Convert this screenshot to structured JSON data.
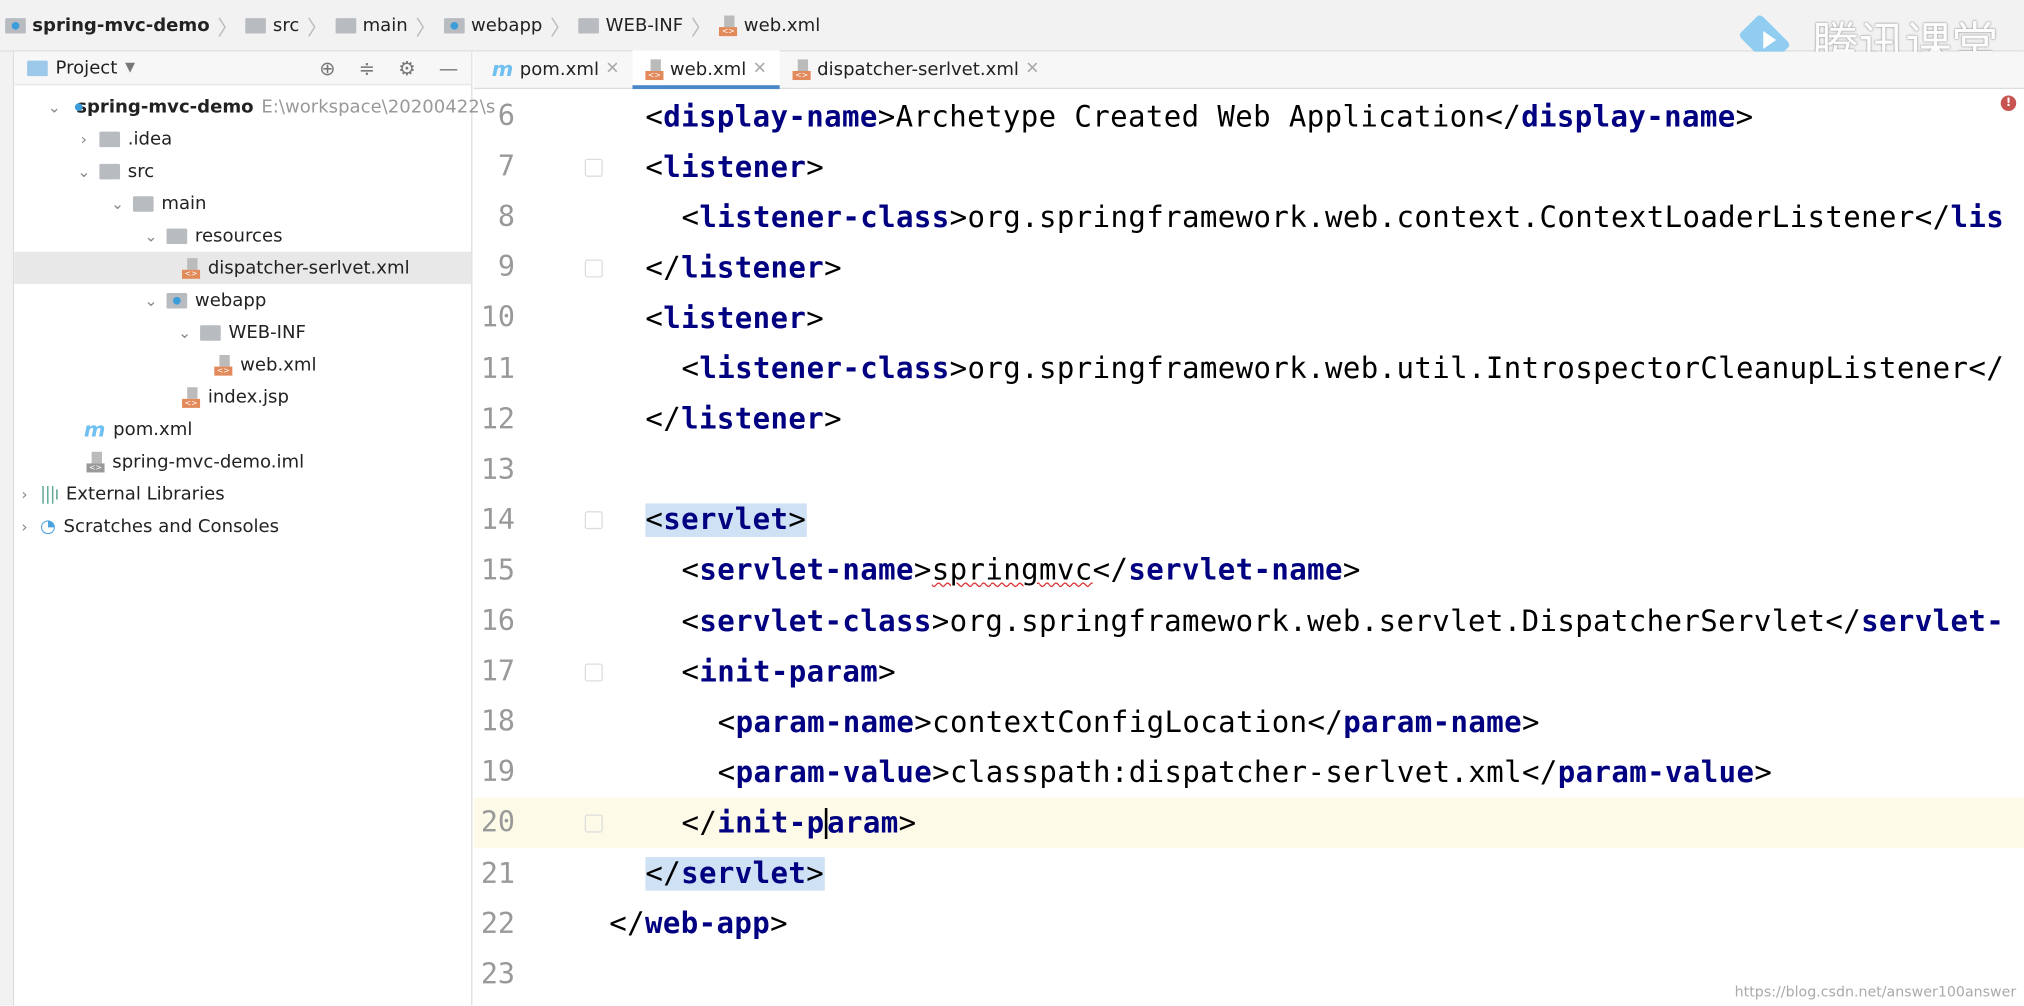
{
  "breadcrumb": [
    {
      "label": "spring-mvc-demo",
      "icon": "module-icon"
    },
    {
      "label": "src",
      "icon": "folder-icon"
    },
    {
      "label": "main",
      "icon": "folder-icon"
    },
    {
      "label": "webapp",
      "icon": "web-folder-icon"
    },
    {
      "label": "WEB-INF",
      "icon": "folder-icon"
    },
    {
      "label": "web.xml",
      "icon": "xml-file-icon"
    }
  ],
  "project_panel": {
    "title": "Project",
    "root": {
      "label": "spring-mvc-demo",
      "path": "E:\\workspace\\20200422\\s"
    },
    "items": [
      ".idea",
      "src",
      "main",
      "resources",
      "dispatcher-serlvet.xml",
      "webapp",
      "WEB-INF",
      "web.xml",
      "index.jsp",
      "pom.xml",
      "spring-mvc-demo.iml",
      "External Libraries",
      "Scratches and Consoles"
    ]
  },
  "tabs": [
    {
      "label": "pom.xml",
      "active": false
    },
    {
      "label": "web.xml",
      "active": true
    },
    {
      "label": "dispatcher-serlvet.xml",
      "active": false
    }
  ],
  "code": {
    "current_line": 20,
    "lines": [
      {
        "n": "6",
        "text": [
          "<",
          "display-name",
          ">Archetype Created Web Application</",
          "display-name",
          ">"
        ]
      },
      {
        "n": "7",
        "text": [
          "<",
          "listener",
          ">"
        ]
      },
      {
        "n": "8",
        "text": [
          "<",
          "listener-class",
          ">org.springframework.web.context.ContextLoaderListener</",
          "lis"
        ]
      },
      {
        "n": "9",
        "text": [
          "</",
          "listener",
          ">"
        ]
      },
      {
        "n": "10",
        "text": [
          "<",
          "listener",
          ">"
        ]
      },
      {
        "n": "11",
        "text": [
          "<",
          "listener-class",
          ">org.springframework.web.util.IntrospectorCleanupListener</"
        ]
      },
      {
        "n": "12",
        "text": [
          "</",
          "listener",
          ">"
        ]
      },
      {
        "n": "13",
        "text": []
      },
      {
        "n": "14",
        "text": [
          "<",
          "servlet",
          ">"
        ]
      },
      {
        "n": "15",
        "text": [
          "<",
          "servlet-name",
          ">springmvc</",
          "servlet-name",
          ">"
        ]
      },
      {
        "n": "16",
        "text": [
          "<",
          "servlet-class",
          ">org.springframework.web.servlet.DispatcherServlet</",
          "servlet-"
        ]
      },
      {
        "n": "17",
        "text": [
          "<",
          "init-param",
          ">"
        ]
      },
      {
        "n": "18",
        "text": [
          "<",
          "param-name",
          ">contextConfigLocation</",
          "param-name",
          ">"
        ]
      },
      {
        "n": "19",
        "text": [
          "<",
          "param-value",
          ">classpath:dispatcher-serlvet.xml</",
          "param-value",
          ">"
        ]
      },
      {
        "n": "20",
        "text": [
          "</",
          "init-param",
          ">"
        ]
      },
      {
        "n": "21",
        "text": [
          "</",
          "servlet",
          ">"
        ]
      },
      {
        "n": "22",
        "text": [
          "</",
          "web-app",
          ">"
        ]
      },
      {
        "n": "23",
        "text": []
      }
    ]
  },
  "watermark": {
    "brand": "腾讯课堂",
    "url": "https://blog.csdn.net/answer100answer"
  },
  "colors": {
    "tag": "#000080",
    "highlight": "#cfe2f5",
    "current_line": "#fdfbe8",
    "tab_underline": "#4a88c7"
  }
}
